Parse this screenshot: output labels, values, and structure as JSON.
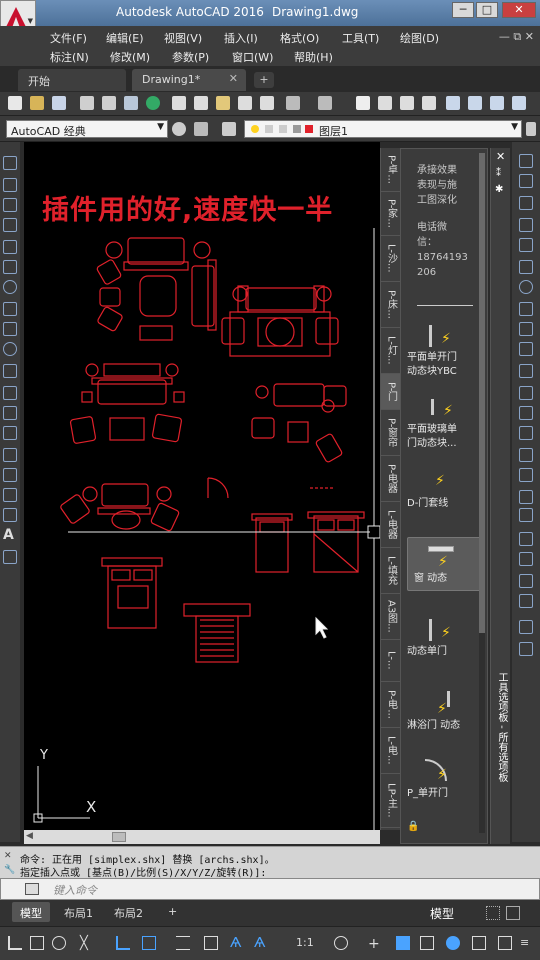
{
  "titlebar": {
    "app_title": "Autodesk AutoCAD 2016",
    "document_title": "Drawing1.dwg",
    "buttons": [
      "─",
      "□",
      "✕"
    ]
  },
  "menubar": {
    "row1": [
      "文件(F)",
      "编辑(E)",
      "视图(V)",
      "插入(I)",
      "格式(O)",
      "工具(T)",
      "绘图(D)"
    ],
    "row2": [
      "标注(N)",
      "修改(M)",
      "参数(P)",
      "窗口(W)",
      "帮助(H)"
    ],
    "doc_controls": "— ⧉ ✕"
  },
  "tabs": {
    "start": "开始",
    "drawing": "Drawing1*",
    "close": "✕",
    "add": "+"
  },
  "toolbar": {
    "workspace": "AutoCAD 经典",
    "layer": "图层1"
  },
  "canvas": {
    "overlay_text": "插件用的好,速度快一半",
    "ucs_y": "Y",
    "ucs_x": "X"
  },
  "palette": {
    "info_lines": [
      "承接效果",
      "表现与施",
      "工图深化",
      "",
      "电话微",
      "信：",
      "18764193",
      "206"
    ],
    "tools": [
      {
        "label1": "平面单开门",
        "label2": "动态块YBC"
      },
      {
        "label1": "平面玻璃单",
        "label2": "门动态块..."
      },
      {
        "label1": "D-门套线",
        "label2": ""
      },
      {
        "label1": "窗 动态",
        "label2": ""
      },
      {
        "label1": "动态单门",
        "label2": ""
      },
      {
        "label1": "淋浴门 动态",
        "label2": ""
      },
      {
        "label1": "P_单开门",
        "label2": ""
      }
    ],
    "tabs": [
      "P-卓...",
      "P-家...",
      "L-沙...",
      "P-床...",
      "L-灯...",
      "P-门",
      "P-窗帘",
      "P-电器",
      "L-电器",
      "L-填充",
      "A3图...",
      "L-...",
      "P-电...",
      "L-电...",
      "LP-主..."
    ],
    "title": "工具选项板 - 所有选项板"
  },
  "command": {
    "line1": "命令:  正在用 [simplex.shx] 替换 [archs.shx]。",
    "line2": "指定插入点或 [基点(B)/比例(S)/X/Y/Z/旋转(R)]:",
    "placeholder": "键入命令"
  },
  "layout_tabs": {
    "model": "模型",
    "layout1": "布局1",
    "layout2": "布局2",
    "add": "+",
    "model_button": "模型"
  },
  "statusbar": {
    "scale": "1:1"
  },
  "colors": {
    "cad_red": "#e0212b",
    "bolt": "#ffd21f",
    "accent": "#4d7199"
  }
}
